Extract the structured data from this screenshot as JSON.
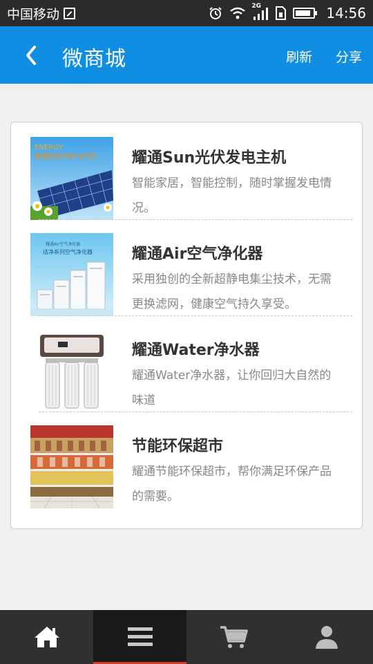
{
  "status_bar": {
    "carrier": "中国移动",
    "network": "2G",
    "time": "14:56",
    "battery_level": 0.85
  },
  "header": {
    "title": "微商城",
    "refresh_label": "刷新",
    "share_label": "分享",
    "back_icon": "chevron-left-icon"
  },
  "products": [
    {
      "name": "耀通Sun光伏发电主机",
      "desc": "智能家居，智能控制，随时掌握发电情况。",
      "thumb_text_1": "ENERGY",
      "thumb_text_2": "耀通家用并网光伏主机"
    },
    {
      "name": "耀通Air空气净化器",
      "desc": "采用独创的全新超静电集尘技术，无需更换滤网，健康空气持久享受。",
      "thumb_text_1": "耀通Air空气净化器",
      "thumb_text_2": "适净系列空气净化器"
    },
    {
      "name": "耀通Water净水器",
      "desc": "耀通Water净水器，让你回归大自然的味道"
    },
    {
      "name": "节能环保超市",
      "desc": "耀通节能环保超市，帮你满足环保产品的需要。"
    }
  ],
  "bottom_nav": {
    "active_index": 1,
    "items": [
      "home-icon",
      "menu-icon",
      "cart-icon",
      "user-icon"
    ]
  },
  "colors": {
    "header": "#0f8ee3",
    "status_bar": "#2b2b2b",
    "nav_bg": "#303030",
    "nav_active_indicator": "#d23a2a"
  }
}
